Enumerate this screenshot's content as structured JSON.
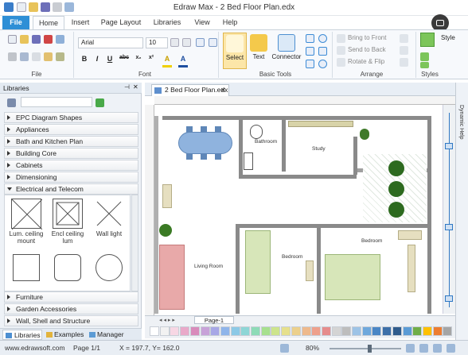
{
  "window": {
    "title": "Edraw Max - 2 Bed Floor Plan.edx"
  },
  "tabs": [
    {
      "label": "File"
    },
    {
      "label": "Home"
    },
    {
      "label": "Insert"
    },
    {
      "label": "Page Layout"
    },
    {
      "label": "Libraries"
    },
    {
      "label": "View"
    },
    {
      "label": "Help"
    }
  ],
  "ribbon": {
    "file_group": "File",
    "font_group": "Font",
    "font_name": "Arial",
    "font_size": "10",
    "format_buttons": [
      "B",
      "I",
      "U",
      "abc",
      "x₂",
      "x²",
      "A",
      "A"
    ],
    "basic_tools_group": "Basic Tools",
    "select_label": "Select",
    "text_label": "Text",
    "connector_label": "Connector",
    "arrange_group": "Arrange",
    "bring_to_front": "Bring to Front",
    "send_to_back": "Send to Back",
    "rotate_flip": "Rotate & Flip",
    "styles_group": "Styles",
    "style_label": "Style"
  },
  "libraries": {
    "title": "Libraries",
    "categories_top": [
      "EPC Diagram Shapes",
      "Appliances",
      "Bath and Kitchen Plan",
      "Building Core",
      "Cabinets",
      "Dimensioning",
      "Electrical and Telecom"
    ],
    "shapes": [
      {
        "label": "Lum. ceiling mount"
      },
      {
        "label": "Encl ceiling lum"
      },
      {
        "label": "Wall light"
      }
    ],
    "categories_bottom": [
      "Furniture",
      "Garden Accessories",
      "Wall, Shell and Structure"
    ],
    "bottom_tabs": [
      "Libraries",
      "Examples",
      "Manager"
    ]
  },
  "document": {
    "tab_label": "2 Bed Floor Plan.edx",
    "page_tab": "Page-1",
    "rooms": [
      "Bathroom",
      "Study",
      "Bedroom",
      "Living Room",
      "Bedroom"
    ]
  },
  "right_panel": {
    "label": "Dynamic Help"
  },
  "status": {
    "website": "www.edrawsoft.com",
    "page": "Page 1/1",
    "coords": "X = 197.7, Y= 162.0",
    "zoom": "80%"
  },
  "palette_colors": [
    "#ffffff",
    "#f2f2f2",
    "#f7d7e4",
    "#e9a9c9",
    "#d98bbb",
    "#c8a2d8",
    "#a7a7e6",
    "#8fb5ea",
    "#8cc9e6",
    "#8ed6d6",
    "#8edbb7",
    "#a7e08e",
    "#cde48c",
    "#e6e08c",
    "#ecd08c",
    "#eeb98c",
    "#eea08c",
    "#e68c8c",
    "#d4d4d4",
    "#bdbdbd",
    "#9dc3e6",
    "#6fa8dc",
    "#4a86c5",
    "#3d6fa8",
    "#2f5b8c",
    "#5b9bd5",
    "#70ad47",
    "#ffc000",
    "#ed7d31",
    "#a5a5a5"
  ]
}
